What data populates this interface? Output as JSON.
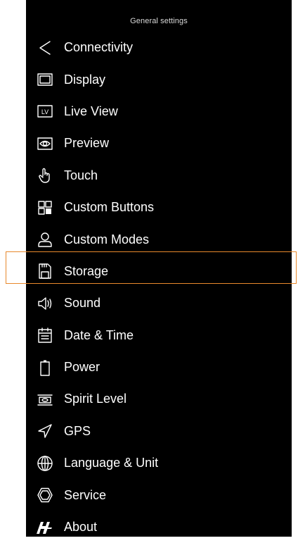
{
  "header": {
    "title": "General settings"
  },
  "menu": {
    "items": [
      {
        "label": "Connectivity",
        "icon": "share-icon"
      },
      {
        "label": "Display",
        "icon": "display-icon"
      },
      {
        "label": "Live View",
        "icon": "live-view-icon"
      },
      {
        "label": "Preview",
        "icon": "eye-icon"
      },
      {
        "label": "Touch",
        "icon": "hand-pointer-icon"
      },
      {
        "label": "Custom Buttons",
        "icon": "grid-icon"
      },
      {
        "label": "Custom Modes",
        "icon": "user-icon"
      },
      {
        "label": "Storage",
        "icon": "sd-card-icon"
      },
      {
        "label": "Sound",
        "icon": "speaker-icon"
      },
      {
        "label": "Date & Time",
        "icon": "calendar-icon"
      },
      {
        "label": "Power",
        "icon": "battery-icon"
      },
      {
        "label": "Spirit Level",
        "icon": "level-icon"
      },
      {
        "label": "GPS",
        "icon": "location-arrow-icon"
      },
      {
        "label": "Language & Unit",
        "icon": "globe-icon"
      },
      {
        "label": "Service",
        "icon": "hexagon-icon"
      },
      {
        "label": "About",
        "icon": "hasselblad-logo-icon"
      }
    ],
    "highlighted": "Storage"
  },
  "colors": {
    "background": "#000000",
    "text": "#ffffff",
    "highlight_border": "#e8892c"
  }
}
